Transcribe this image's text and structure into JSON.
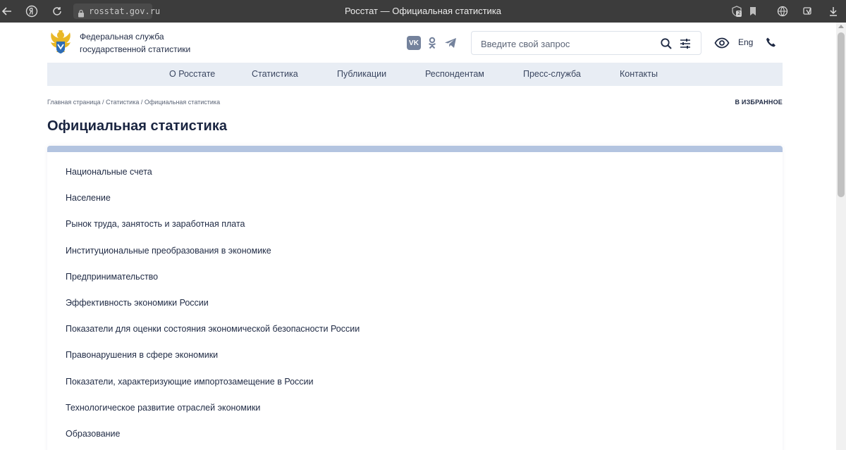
{
  "browser": {
    "url": "rosstat.gov.ru",
    "tab_title": "Росстат — Официальная статистика",
    "badge_count": "2"
  },
  "header": {
    "org_name_line1": "Федеральная служба",
    "org_name_line2": "государственной статистики",
    "social": {
      "vk": "VK"
    },
    "search_placeholder": "Введите свой запрос",
    "lang": "Eng"
  },
  "nav": {
    "items": [
      "О Росстате",
      "Статистика",
      "Публикации",
      "Респондентам",
      "Пресс-служба",
      "Контакты"
    ]
  },
  "breadcrumb": {
    "items": [
      "Главная страница",
      "Статистика",
      "Официальная статистика"
    ],
    "separator": " /",
    "favorites": "В ИЗБРАННОЕ"
  },
  "page": {
    "title": "Официальная статистика",
    "categories": [
      "Национальные счета",
      "Население",
      "Рынок труда, занятость и заработная плата",
      "Институциональные преобразования в экономике",
      "Предпринимательство",
      "Эффективность экономики России",
      "Показатели для оценки состояния экономической безопасности России",
      "Правонарушения в сфере экономики",
      "Показатели, характеризующие импортозамещение в России",
      "Технологическое развитие отраслей экономики",
      "Образование"
    ]
  },
  "colors": {
    "chrome_bg": "#3c3c3c",
    "nav_bg": "#e8edf4",
    "panel_accent": "#b3c4e0",
    "text_dark": "#1f2a44"
  }
}
